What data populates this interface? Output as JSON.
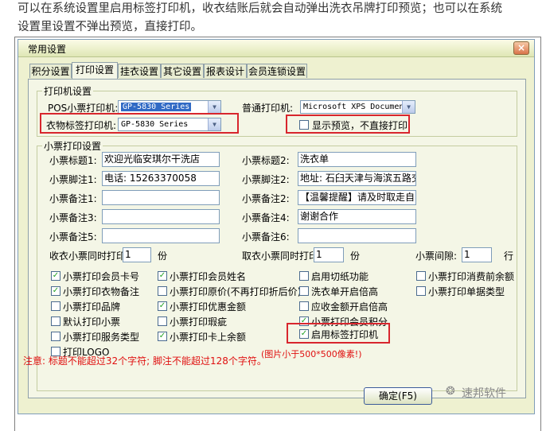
{
  "article": {
    "line1": "可以在系统设置里启用标签打印机，收衣结账后就会自动弹出洗衣吊牌打印预览；也可以在系统",
    "line2": "设置里设置不弹出预览，直接打印。"
  },
  "window": {
    "title": "常用设置",
    "close_glyph": "×",
    "tabs": [
      {
        "label": "积分设置"
      },
      {
        "label": "打印设置"
      },
      {
        "label": "挂衣设置"
      },
      {
        "label": "其它设置"
      },
      {
        "label": "报表设计"
      },
      {
        "label": "会员连锁设置"
      }
    ],
    "active_tab": "打印设置"
  },
  "printer_group": {
    "title": "打印机设置",
    "pos_label": "POS小票打印机:",
    "pos_value": "GP-5830 Series",
    "normal_label": "普通打印机:",
    "normal_value": "Microsoft XPS Document",
    "tag_label": "衣物标签打印机:",
    "tag_value": "GP-5830 Series",
    "preview_label": "显示预览，不直接打印",
    "preview_checked": false
  },
  "receipt_group": {
    "title": "小票打印设置",
    "fields": {
      "title1_label": "小票标题1:",
      "title1_value": "欢迎光临安琪尔干洗店",
      "title2_label": "小票标题2:",
      "title2_value": "洗衣单",
      "foot1_label": "小票脚注1:",
      "foot1_value": "电话: 15263370058",
      "foot2_label": "小票脚注2:",
      "foot2_value": "地址: 石臼天津与海滨五路交",
      "remark1_label": "小票备注1:",
      "remark1_value": "",
      "remark2_label": "小票备注2:",
      "remark2_value": "【温馨提醒】请及时取走自己",
      "remark3_label": "小票备注3:",
      "remark3_value": "",
      "remark4_label": "小票备注4:",
      "remark4_value": "谢谢合作",
      "remark5_label": "小票备注5:",
      "remark5_value": "",
      "remark6_label": "小票备注6:",
      "remark6_value": ""
    },
    "copies": {
      "receive_label": "收衣小票同时打印",
      "receive_value": "1",
      "receive_unit": "份",
      "pickup_label": "取衣小票同时打印",
      "pickup_value": "1",
      "pickup_unit": "份",
      "gap_label": "小票间隙:",
      "gap_value": "1",
      "gap_unit": "行"
    },
    "checkboxes": [
      {
        "label": "小票打印会员卡号",
        "checked": true
      },
      {
        "label": "小票打印会员姓名",
        "checked": true
      },
      {
        "label": "启用切纸功能",
        "checked": false
      },
      {
        "label": "小票打印消费前余额",
        "checked": false
      },
      {
        "label": "小票打印衣物备注",
        "checked": true
      },
      {
        "label": "小票打印原价(不再打印折后价)",
        "checked": false
      },
      {
        "label": "洗衣单开启倍高",
        "checked": false
      },
      {
        "label": "小票打印单据类型",
        "checked": false
      },
      {
        "label": "小票打印品牌",
        "checked": false
      },
      {
        "label": "小票打印优惠金额",
        "checked": true
      },
      {
        "label": "应收金额开启倍高",
        "checked": false
      },
      {
        "label": "默认打印小票",
        "checked": false
      },
      {
        "label": "小票打印瑕疵",
        "checked": false
      },
      {
        "label": "小票打印会员积分",
        "checked": true
      },
      {
        "label": "小票打印服务类型",
        "checked": false
      },
      {
        "label": "小票打印卡上余额",
        "checked": true
      },
      {
        "label": "启用标签打印机",
        "checked": true
      },
      {
        "label": "打印LOGO",
        "checked": false
      }
    ],
    "logo_hint": "(图片小于500*500像素!)"
  },
  "footer": {
    "note": "注意: 标题不能超过32个字符; 脚注不能超过128个字符。",
    "ok_button": "确定(F5)",
    "watermark": "速邦软件"
  },
  "colors": {
    "highlight_red": "#d8262d",
    "note_red": "#e01010",
    "check_green": "#21a121",
    "window_bg": "#eef1d0"
  }
}
